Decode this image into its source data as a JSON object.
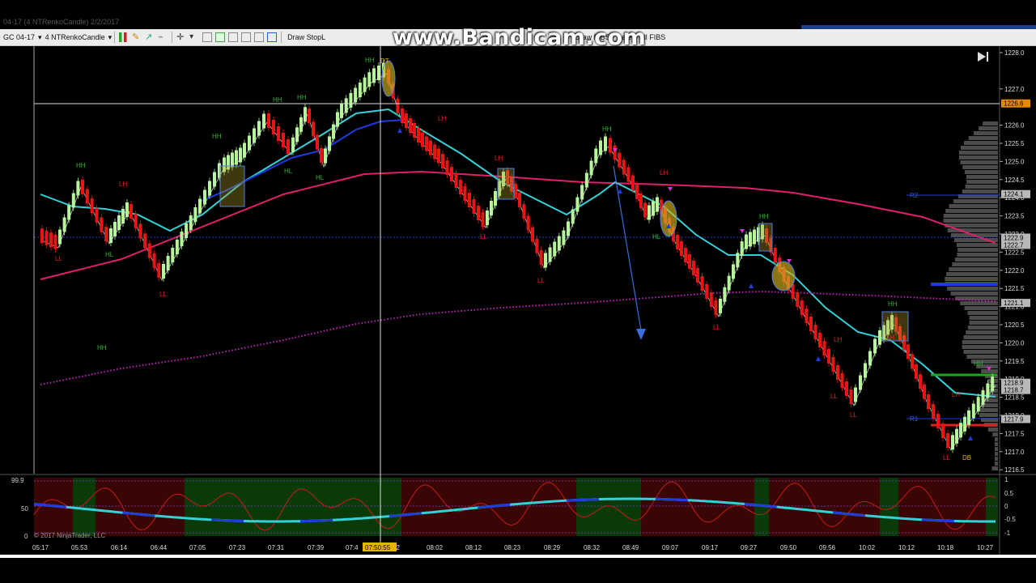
{
  "window": {
    "title": "04-17 (4 NTRenkoCandle) 2/2/2017"
  },
  "toolbar": {
    "instrument": "GC 04-17",
    "chart_type": "4 NTRenkoCandle",
    "draw_stop": "Draw StopL",
    "draw_fibs": "Draw FIBS",
    "delete_fibs": "Delete All FIBS"
  },
  "watermark": "www.Bandicam.com",
  "copyright": "© 2017 NinjaTrader, LLC",
  "crosshair": {
    "time_label": "07:50:55",
    "price_label": "1226.6"
  },
  "price_axis": {
    "ticks": [
      "1228.0",
      "1227.0",
      "1226.0",
      "1225.5",
      "1225.0",
      "1224.5",
      "1224.0",
      "1223.5",
      "1223.0",
      "1222.5",
      "1222.0",
      "1221.5",
      "1221.0",
      "1220.5",
      "1220.0",
      "1219.5",
      "1219.0",
      "1218.5",
      "1218.0",
      "1217.5",
      "1217.0",
      "1216.5"
    ],
    "boxed_labels": [
      "1226.6",
      "1224.1",
      "1222.9",
      "1222.7",
      "1221.1",
      "1218.9",
      "1218.7",
      "1217.9"
    ]
  },
  "time_axis": {
    "ticks": [
      "05:17",
      "05:53",
      "06:14",
      "06:44",
      "07:05",
      "07:23",
      "07:31",
      "07:39",
      "07:4",
      "52",
      "08:02",
      "08:12",
      "08:23",
      "08:29",
      "08:32",
      "08:49",
      "09:07",
      "09:17",
      "09:27",
      "09:50",
      "09:56",
      "10:02",
      "10:12",
      "10:18",
      "10:27"
    ]
  },
  "osc_axis": {
    "left_top": "99.9",
    "left_mid": "50",
    "left_bot": "0",
    "right": [
      "1",
      "0.5",
      "0",
      "-0.5",
      "-1"
    ]
  },
  "annotations": [
    "HH",
    "HH",
    "HH",
    "HH",
    "HH",
    "HH",
    "HH",
    "HH",
    "HH",
    "HH",
    "LH",
    "LH",
    "LH",
    "LH",
    "LH",
    "LH",
    "LH",
    "LL",
    "LL",
    "LL",
    "LL",
    "LL",
    "LL",
    "LL",
    "LL",
    "HL",
    "HL",
    "HL",
    "HL",
    "DT",
    "DB",
    "R2",
    "R1"
  ],
  "colors": {
    "up": "#b7f59a",
    "down": "#e81515",
    "teal": "#35d1d8",
    "magenta": "#e0206a",
    "blue": "#1f3bdf",
    "band_green": "#0a3a0a",
    "band_red": "#3a0505"
  }
}
